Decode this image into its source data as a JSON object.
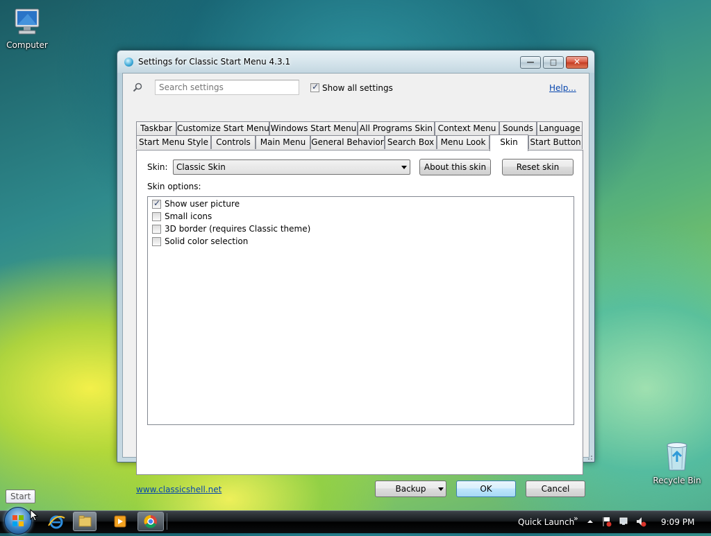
{
  "desktop": {
    "icons": [
      {
        "label": "Computer"
      },
      {
        "label": "Recycle Bin"
      }
    ]
  },
  "window": {
    "title": "Settings for Classic Start Menu 4.3.1",
    "controls": {
      "minimize": "—",
      "maximize": "□",
      "close": "✕"
    }
  },
  "search": {
    "placeholder": "Search settings",
    "show_all_label": "Show all settings",
    "show_all_checked": true,
    "help_link": "Help..."
  },
  "tabs": {
    "row1": [
      "Taskbar",
      "Customize Start Menu",
      "Windows Start Menu",
      "All Programs Skin",
      "Context Menu",
      "Sounds",
      "Language"
    ],
    "row2": [
      "Start Menu Style",
      "Controls",
      "Main Menu",
      "General Behavior",
      "Search Box",
      "Menu Look",
      "Skin",
      "Start Button"
    ],
    "active": "Skin"
  },
  "skin_panel": {
    "skin_label": "Skin:",
    "skin_value": "Classic Skin",
    "about_button": "About this skin",
    "reset_button": "Reset skin",
    "options_label": "Skin options:",
    "options": [
      {
        "label": "Show user picture",
        "checked": true
      },
      {
        "label": "Small icons",
        "checked": false
      },
      {
        "label": "3D border (requires Classic theme)",
        "checked": false
      },
      {
        "label": "Solid color selection",
        "checked": false
      }
    ]
  },
  "footer": {
    "website": "www.classicshell.net",
    "backup": "Backup",
    "ok": "OK",
    "cancel": "Cancel"
  },
  "taskbar": {
    "start_tooltip": "Start",
    "quick_launch": "Quick Launch",
    "chevron": "»",
    "clock": "9:09 PM"
  },
  "colors": {
    "link": "#0645ad",
    "default_button": "#a7d9f5",
    "close_button": "#c33b22"
  }
}
